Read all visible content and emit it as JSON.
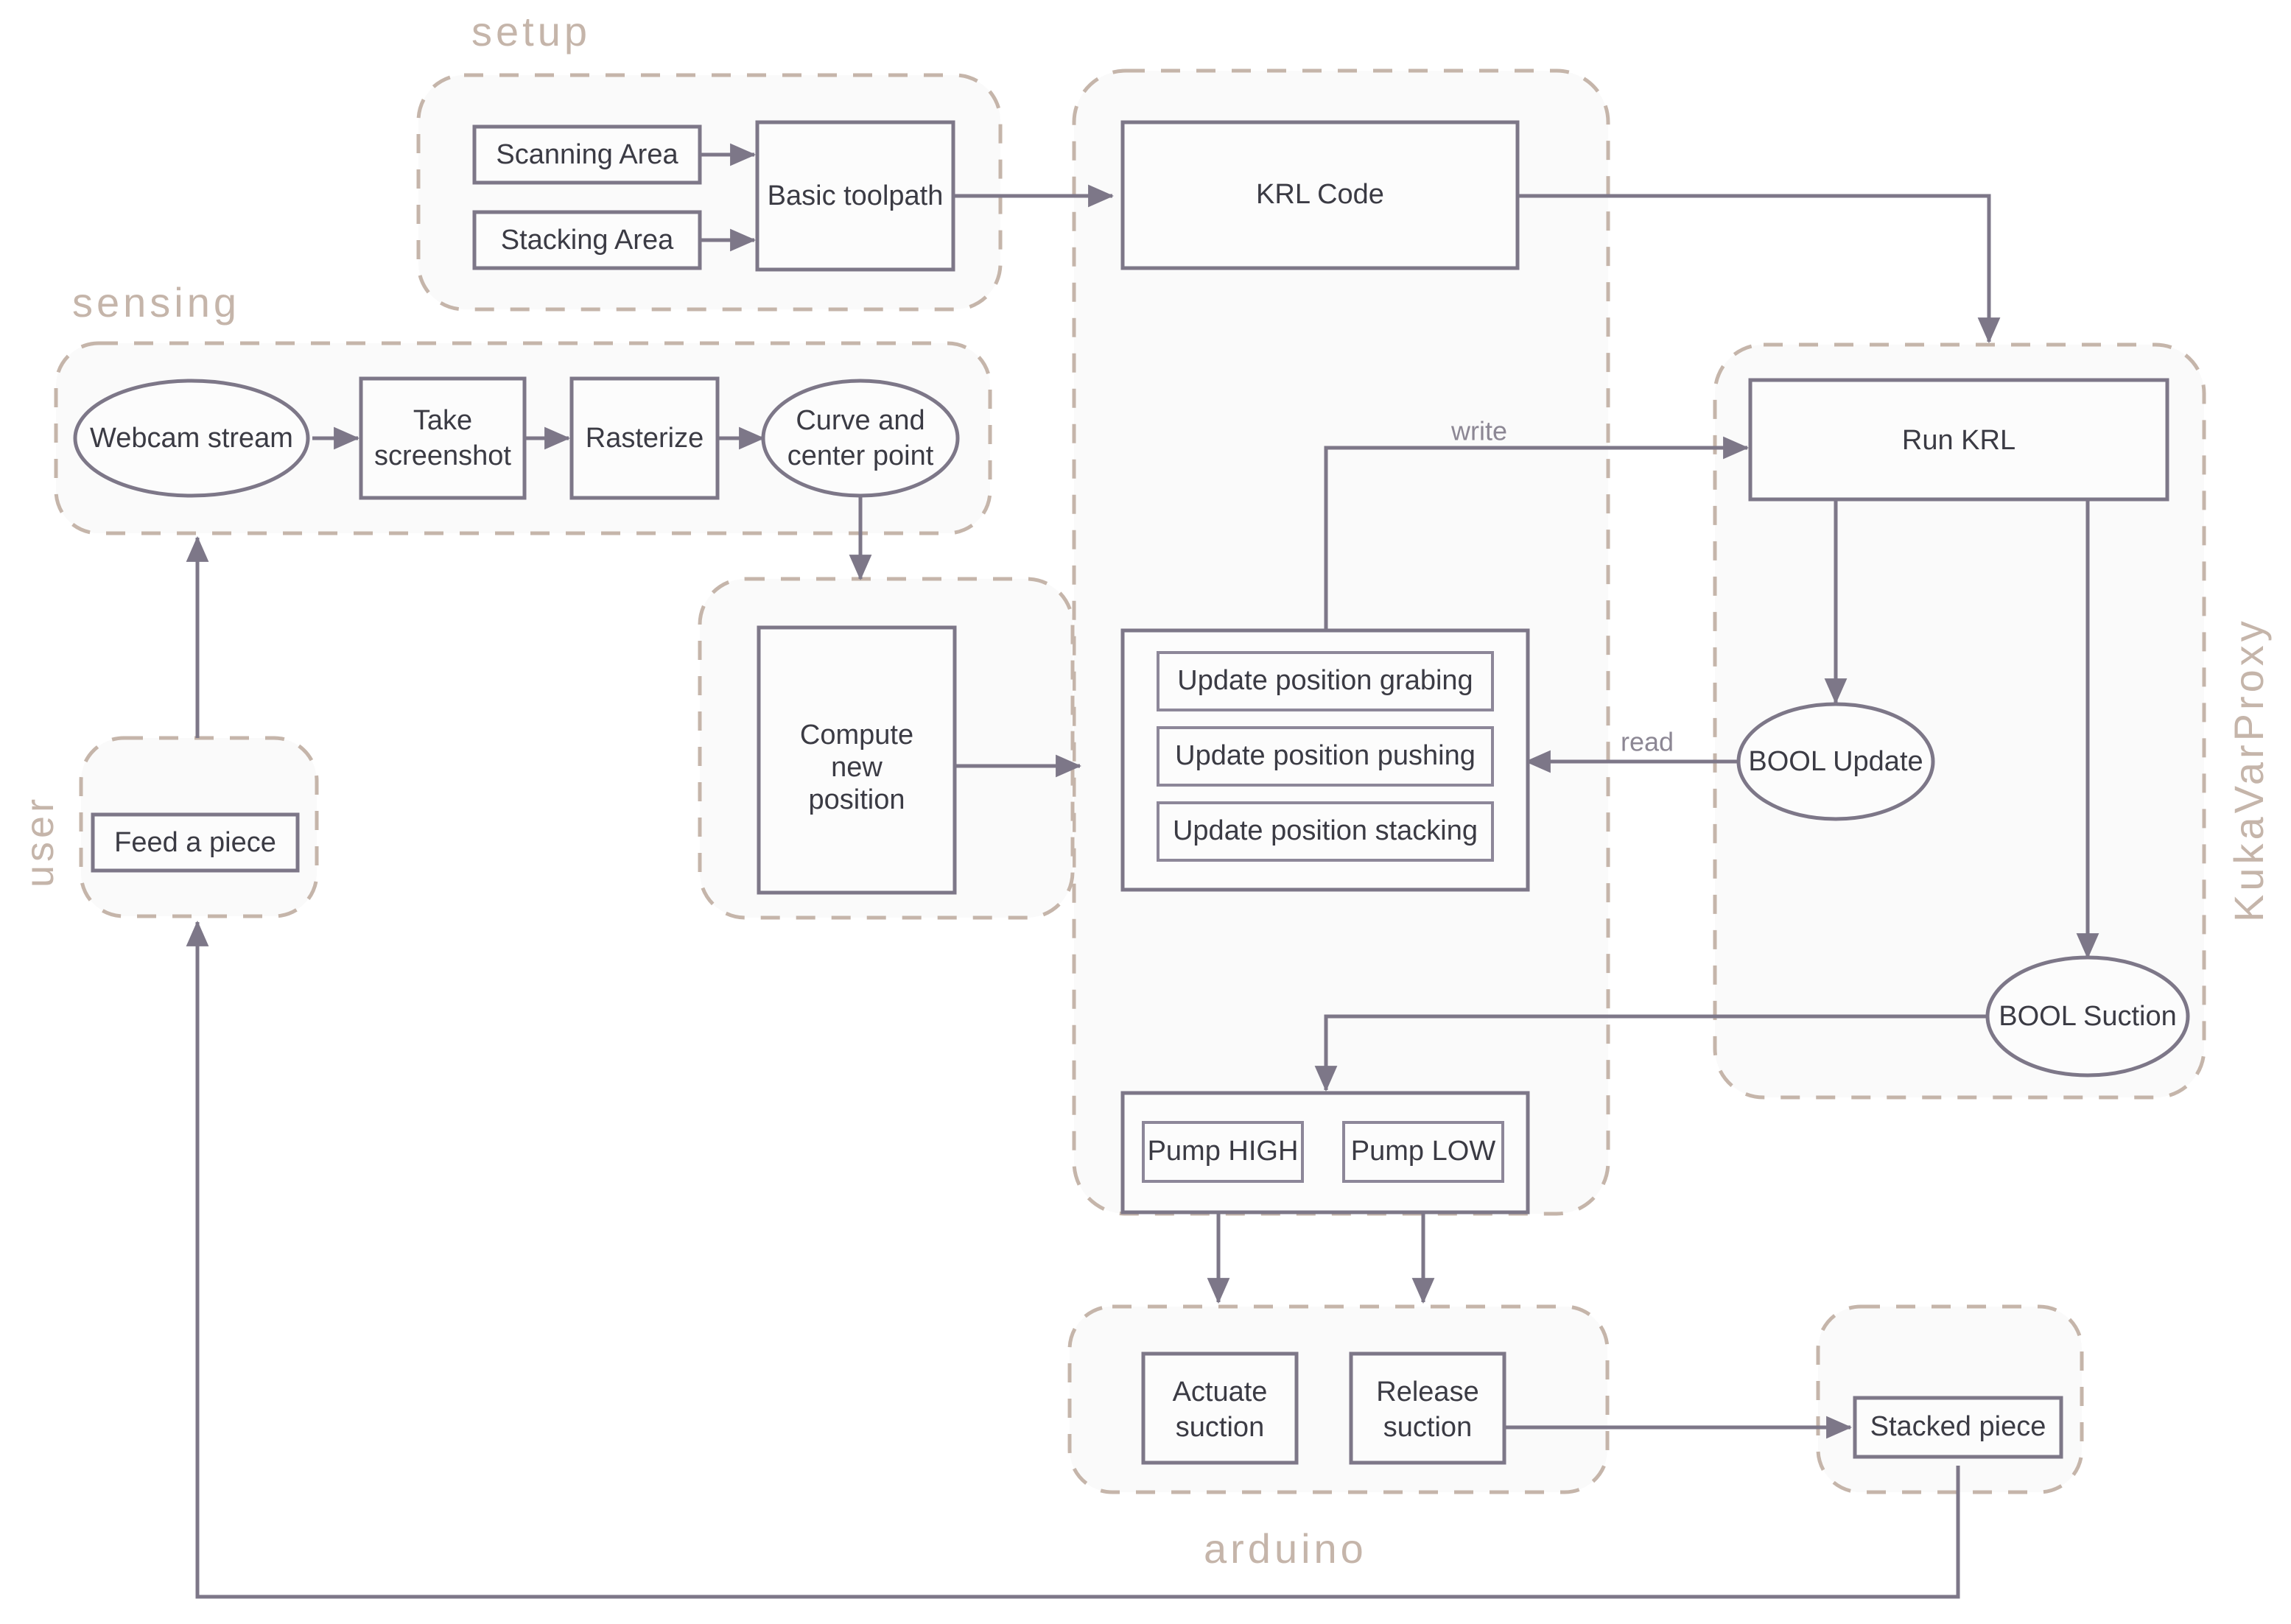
{
  "diagram": {
    "title": "Robotic stacking pipeline flowchart",
    "colors": {
      "group_border": "#c5b5aa",
      "group_fill": "#fafafa",
      "node_border": "#7d7788",
      "node_fill": "#fcfcfc",
      "node_text": "#3b3b44",
      "edge_label": "#8c8794",
      "background": "#ffffff"
    }
  },
  "groups": {
    "setup": {
      "label": "setup",
      "label_position": "top"
    },
    "sensing": {
      "label": "sensing",
      "label_position": "top"
    },
    "user": {
      "label": "user",
      "label_position": "left-rotated"
    },
    "kukavarproxy": {
      "label": "KukaVarProxy",
      "label_position": "right-rotated"
    },
    "arduino": {
      "label": "arduino",
      "label_position": "bottom"
    },
    "controller": {
      "label": "",
      "label_position": "none"
    },
    "compute": {
      "label": "",
      "label_position": "none"
    },
    "stacked": {
      "label": "",
      "label_position": "none"
    }
  },
  "nodes": {
    "scanning_area": "Scanning Area",
    "stacking_area": "Stacking Area",
    "basic_toolpath": "Basic toolpath",
    "krl_code": "KRL Code",
    "webcam_stream": "Webcam stream",
    "take_screenshot_l1": "Take",
    "take_screenshot_l2": "screenshot",
    "rasterize": "Rasterize",
    "curve_center_l1": "Curve and",
    "curve_center_l2": "center point",
    "feed_a_piece": "Feed a piece",
    "compute_new_position_l1": "Compute",
    "compute_new_position_l2": "new",
    "compute_new_position_l3": "position",
    "update_position_grabing": "Update position grabing",
    "update_position_pushing": "Update position pushing",
    "update_position_stacking": "Update position stacking",
    "run_krl": "Run KRL",
    "bool_update": "BOOL Update",
    "bool_suction": "BOOL Suction",
    "pump_high": "Pump HIGH",
    "pump_low": "Pump LOW",
    "actuate_suction_l1": "Actuate",
    "actuate_suction_l2": "suction",
    "release_suction_l1": "Release",
    "release_suction_l2": "suction",
    "stacked_piece": "Stacked piece"
  },
  "edge_labels": {
    "write": "write",
    "read": "read"
  }
}
